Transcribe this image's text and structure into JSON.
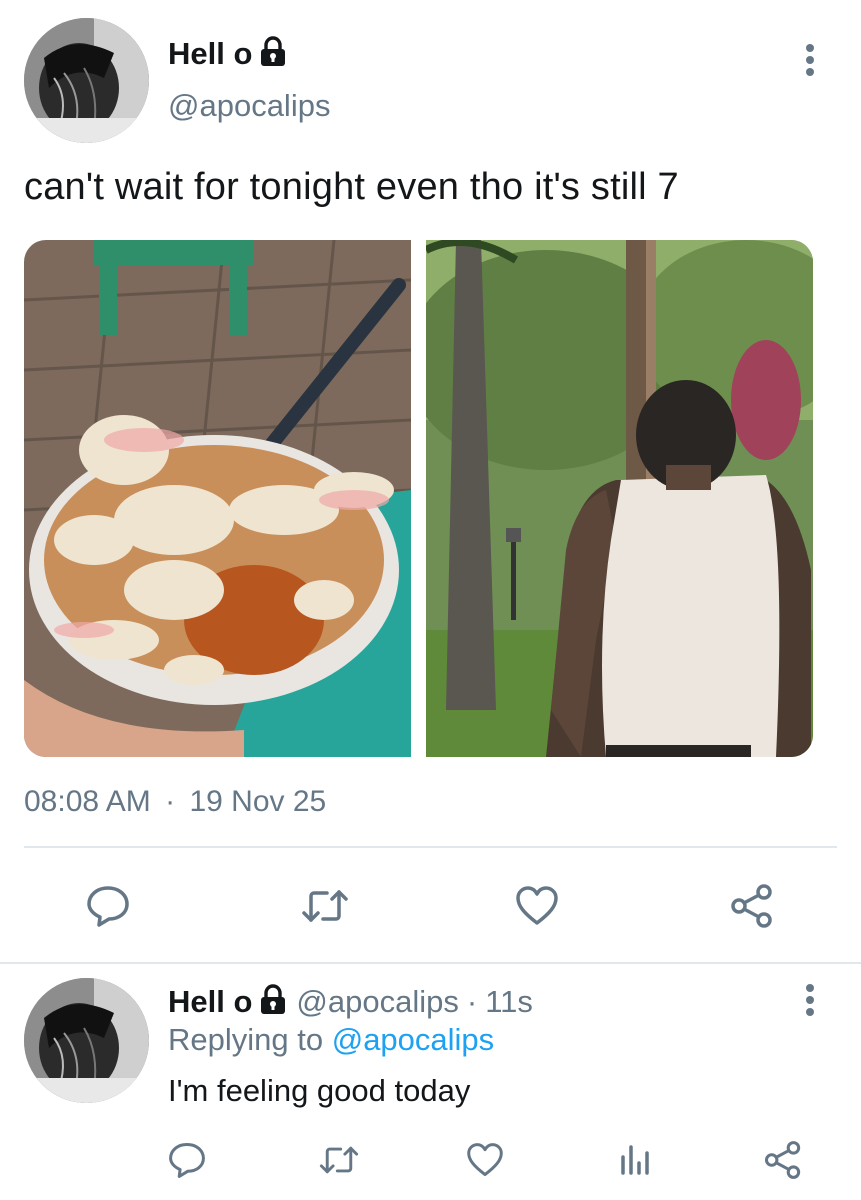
{
  "tweet": {
    "display_name": "Hell o",
    "handle": "@apocalips",
    "text": "can't wait for tonight even tho it's still 7",
    "time": "08:08 AM",
    "separator": "·",
    "date": "19 Nov 25",
    "images": [
      {
        "icon": "food-bowl-photo"
      },
      {
        "icon": "man-tank-top-photo"
      }
    ],
    "actions": [
      "reply-icon",
      "retweet-icon",
      "like-icon",
      "share-icon"
    ]
  },
  "reply": {
    "display_name": "Hell o",
    "handle": "@apocalips",
    "separator": "·",
    "age": "11s",
    "replying_prefix": "Replying to",
    "replying_handle": "@apocalips",
    "text": "I'm feeling good today",
    "actions": [
      "reply-icon",
      "retweet-icon",
      "like-icon",
      "analytics-icon",
      "share-icon"
    ]
  },
  "colors": {
    "text": "#14171a",
    "muted": "#657786",
    "link": "#1da1f2",
    "divider": "#e1e8ed"
  }
}
